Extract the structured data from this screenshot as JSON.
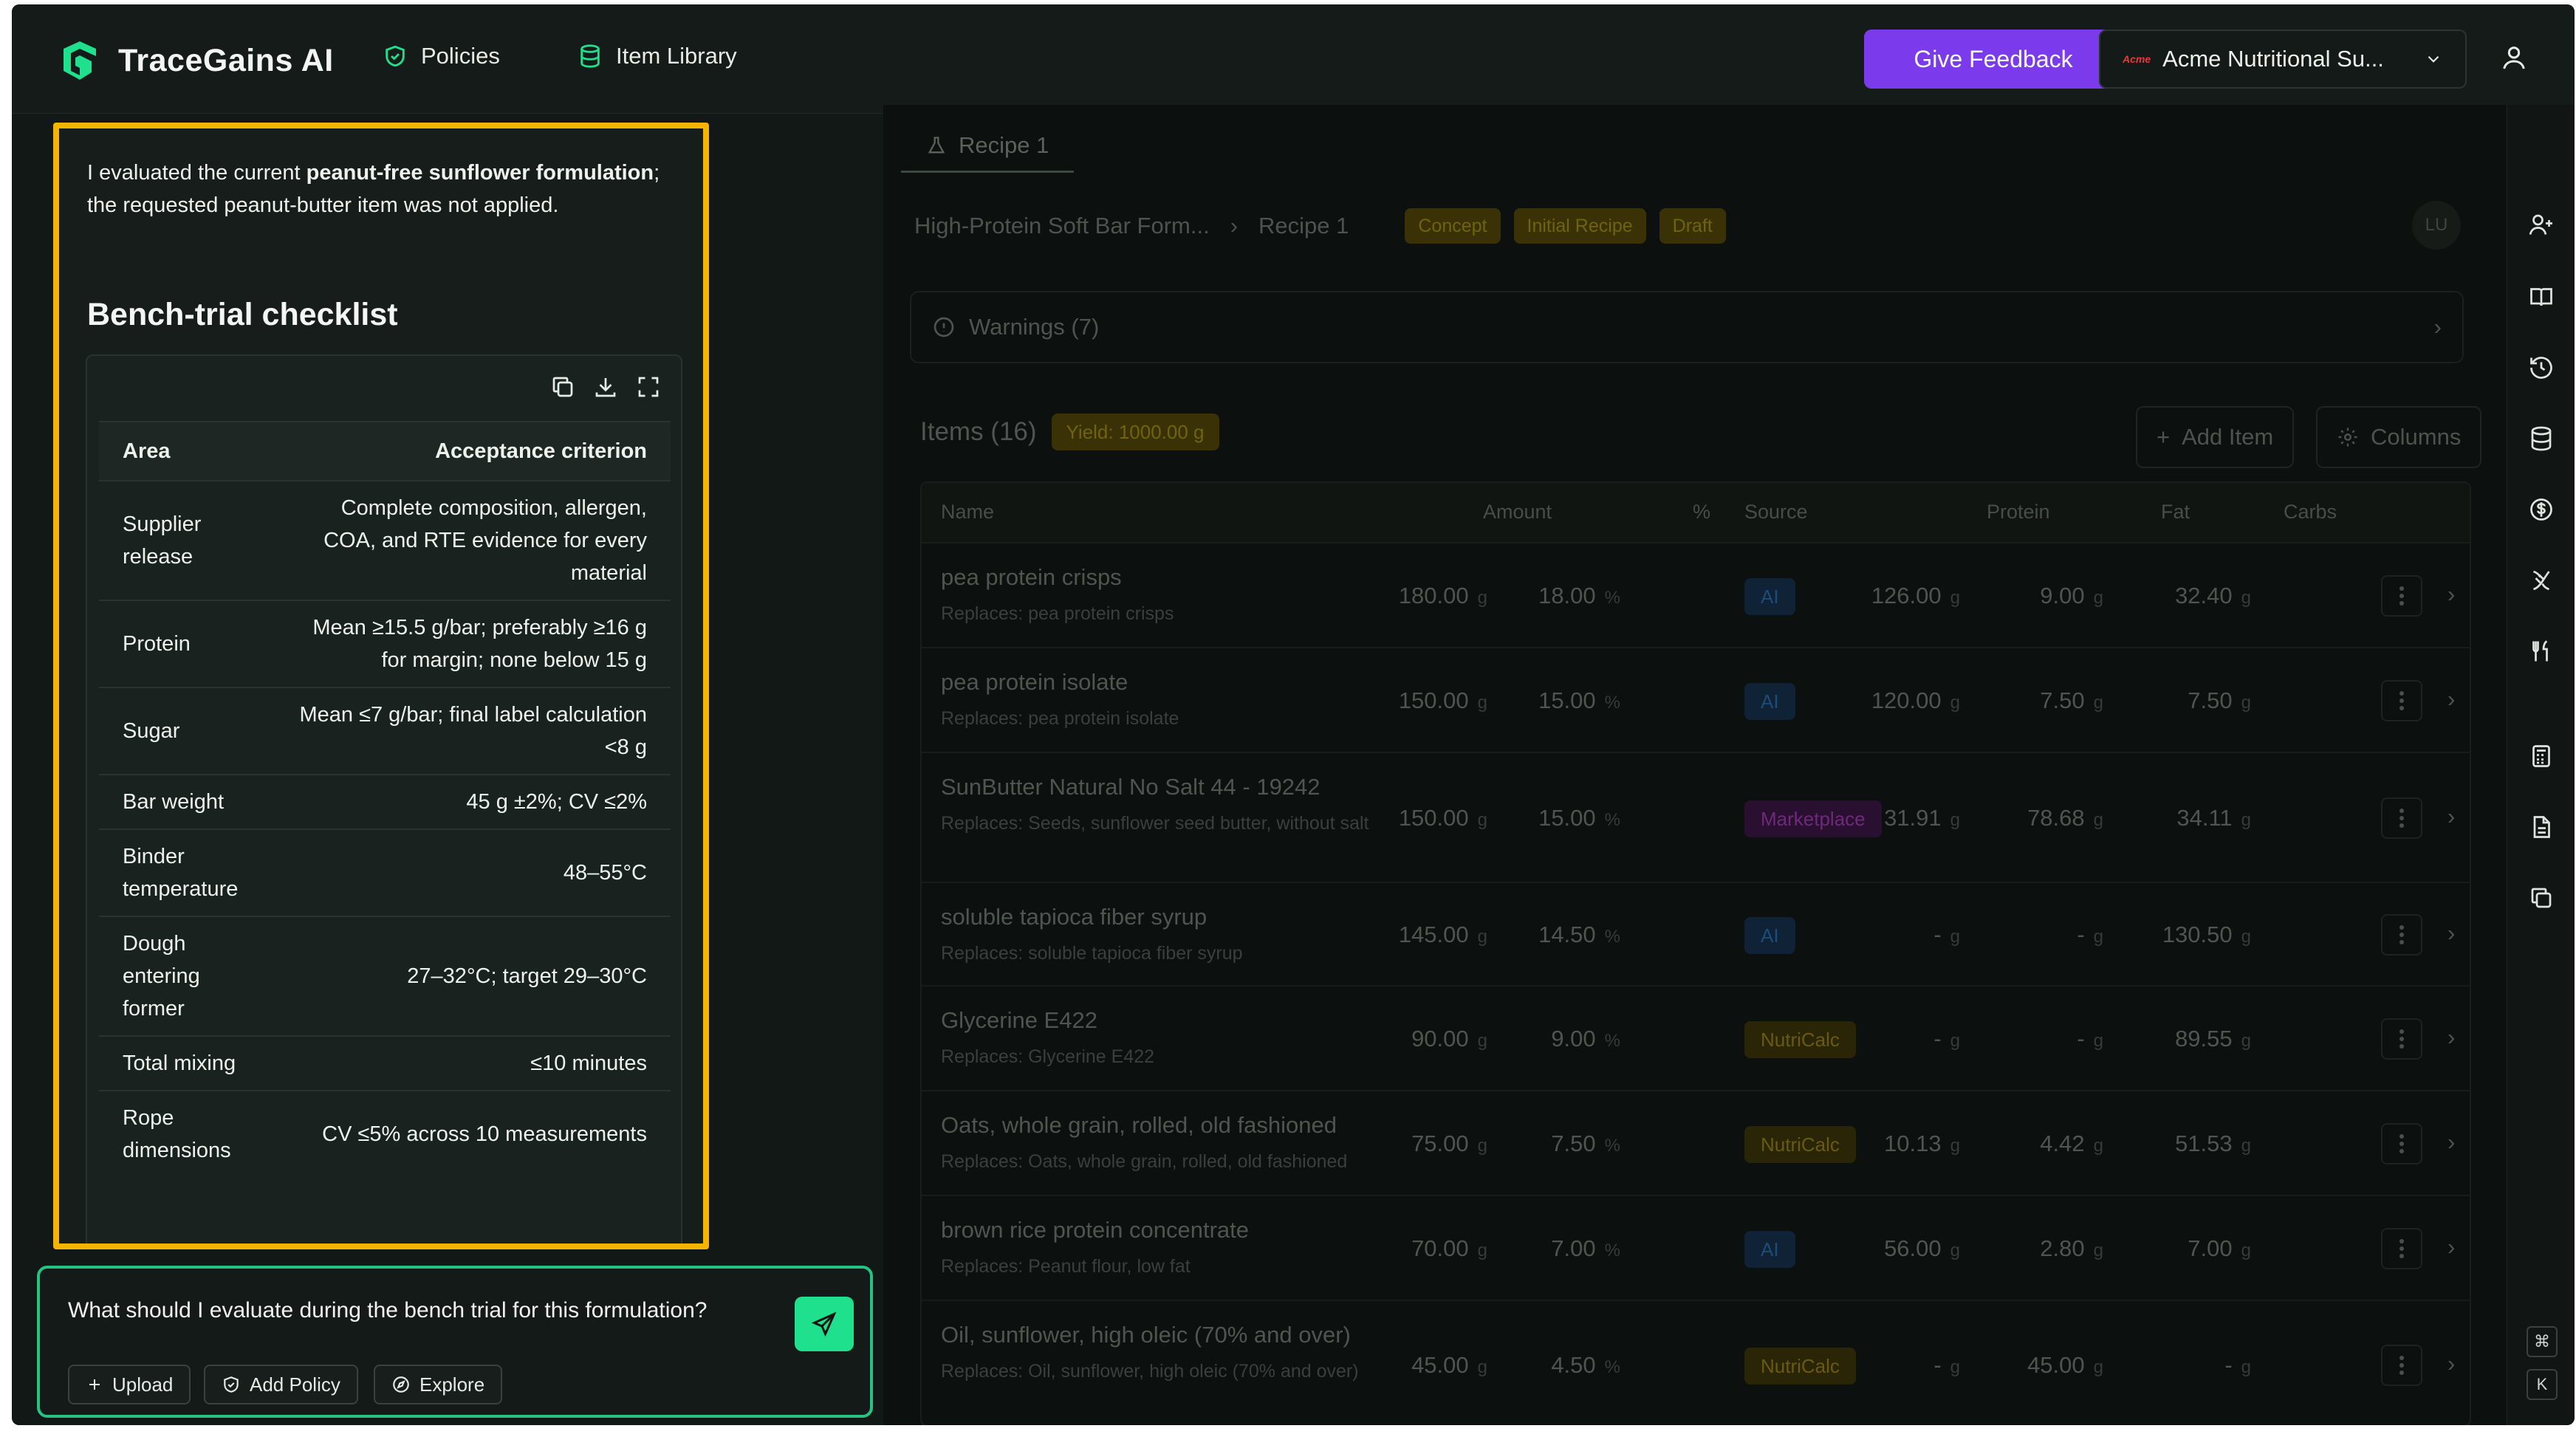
{
  "app": {
    "name": "TraceGains AI"
  },
  "nav": [
    {
      "label": "Policies",
      "icon": "shield-check-icon"
    },
    {
      "label": "Item Library",
      "icon": "database-icon"
    }
  ],
  "header": {
    "feedback_label": "Give Feedback",
    "org_label": "Acme Nutritional Su...",
    "org_logo_text": "Acme"
  },
  "chat": {
    "intro_bold1": "peanut-free sunflower formulation",
    "intro_prefix": "I evaluated the current ",
    "intro_suffix": "; the requested peanut-butter item was not applied.",
    "section_title": "Bench-trial checklist",
    "table": {
      "headers": [
        "Area",
        "Acceptance criterion"
      ],
      "rows": [
        [
          "Supplier release",
          "Complete composition, allergen, COA, and RTE evidence for every material"
        ],
        [
          "Protein",
          "Mean ≥15.5 g/bar; preferably ≥16 g for margin; none below 15 g"
        ],
        [
          "Sugar",
          "Mean ≤7 g/bar; final label calculation <8 g"
        ],
        [
          "Bar weight",
          "45 g ±2%; CV ≤2%"
        ],
        [
          "Binder temperature",
          "48–55°C"
        ],
        [
          "Dough entering former",
          "27–32°C; target 29–30°C"
        ],
        [
          "Total mixing",
          "≤10 minutes"
        ],
        [
          "Rope dimensions",
          "CV ≤5% across 10 measurements"
        ]
      ]
    },
    "input_value": "What should I evaluate during the bench trial for this formulation?",
    "actions": [
      "Upload",
      "Add Policy",
      "Explore"
    ]
  },
  "workspace": {
    "tab_label": "Recipe 1",
    "breadcrumb": [
      "High-Protein Soft Bar Form...",
      "Recipe 1"
    ],
    "tags": [
      "Concept",
      "Initial Recipe",
      "Draft"
    ],
    "avatar": "LU",
    "warnings": "Warnings (7)",
    "items_title": "Items (16)",
    "yield": "Yield: 1000.00 g",
    "add_item": "Add Item",
    "columns": "Columns",
    "col_headers": [
      "Name",
      "Amount",
      "%",
      "Source",
      "Protein",
      "Fat",
      "Carbs"
    ],
    "unit_g": "g",
    "unit_pct": "%",
    "rows": [
      {
        "name": "pea protein crisps",
        "sub": "Replaces: pea protein crisps",
        "amount": "180.00",
        "pct": "18.00",
        "source": "AI",
        "protein": "126.00",
        "fat": "9.00",
        "carbs": "32.40"
      },
      {
        "name": "pea protein isolate",
        "sub": "Replaces: pea protein isolate",
        "amount": "150.00",
        "pct": "15.00",
        "source": "AI",
        "protein": "120.00",
        "fat": "7.50",
        "carbs": "7.50"
      },
      {
        "name": "SunButter Natural No Salt 44 - 19242",
        "sub": "Replaces: Seeds, sunflower seed butter, without salt",
        "amount": "150.00",
        "pct": "15.00",
        "source": "Marketplace",
        "protein": "31.91",
        "fat": "78.68",
        "carbs": "34.11"
      },
      {
        "name": "soluble tapioca fiber syrup",
        "sub": "Replaces: soluble tapioca fiber syrup",
        "amount": "145.00",
        "pct": "14.50",
        "source": "AI",
        "protein": "-",
        "fat": "-",
        "carbs": "130.50"
      },
      {
        "name": "Glycerine E422",
        "sub": "Replaces: Glycerine E422",
        "amount": "90.00",
        "pct": "9.00",
        "source": "NutriCalc",
        "protein": "-",
        "fat": "-",
        "carbs": "89.55"
      },
      {
        "name": "Oats, whole grain, rolled, old fashioned",
        "sub": "Replaces: Oats, whole grain, rolled, old fashioned",
        "amount": "75.00",
        "pct": "7.50",
        "source": "NutriCalc",
        "protein": "10.13",
        "fat": "4.42",
        "carbs": "51.53"
      },
      {
        "name": "brown rice protein concentrate",
        "sub": "Replaces: Peanut flour, low fat",
        "amount": "70.00",
        "pct": "7.00",
        "source": "AI",
        "protein": "56.00",
        "fat": "2.80",
        "carbs": "7.00"
      },
      {
        "name": "Oil, sunflower, high oleic (70% and over)",
        "sub": "Replaces: Oil, sunflower, high oleic (70% and over)",
        "amount": "45.00",
        "pct": "4.50",
        "source": "NutriCalc",
        "protein": "-",
        "fat": "45.00",
        "carbs": "-"
      }
    ]
  },
  "rail": {
    "shortcut_keys": [
      "⌘",
      "K"
    ]
  },
  "colors": {
    "accent_green": "#1ee08d",
    "feedback_purple": "#7c3aed",
    "highlight_yellow": "#f5b400"
  }
}
